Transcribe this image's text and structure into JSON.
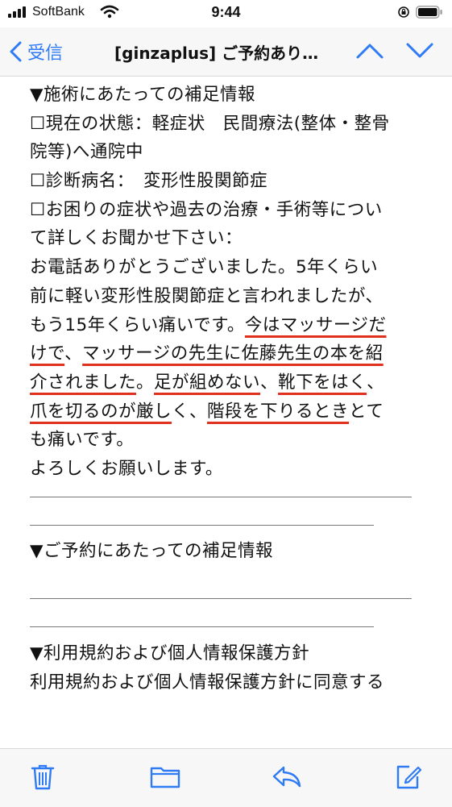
{
  "status_bar": {
    "carrier": "SoftBank",
    "time": "9:44"
  },
  "nav": {
    "back_label": "受信",
    "title": "[ginzaplus] ご予約あり…"
  },
  "body": {
    "l1": "▼施術にあたっての補足情報",
    "l2": "☐現在の状態：軽症状　民間療法(整体・整骨",
    "l3": "院等)へ通院中",
    "l4": "☐診断病名：　変形性股関節症",
    "l5": "☐お困りの症状や過去の治療・手術等につい",
    "l6": "て詳しくお聞かせ下さい：",
    "l7": "お電話ありがとうございました。5年くらい",
    "l8": "前に軽い変形性股関節症と言われましたが、",
    "l9a": "もう15年くらい痛いです。",
    "l9b": "今はマッサージだ",
    "l10a": "けで",
    "l10b": "、",
    "l10c": "マッサージの先生に佐藤先生の本を紹",
    "l11a": "介されました",
    "l11b": "。",
    "l11c": "足が組めない",
    "l11d": "、",
    "l11e": "靴下をはく",
    "l11f": "、",
    "l12a": "爪を切るのが厳し",
    "l12b": "く、",
    "l12c": "階段を下りるとき",
    "l12d": "とて",
    "l13": "も痛いです。",
    "l14": "よろしくお願いします。",
    "l15": "▼ご予約にあたっての補足情報",
    "l16": "▼利用規約および個人情報保護方針",
    "l17": "利用規約および個人情報保護方針に同意する"
  },
  "toolbar": {
    "icons": [
      "trash-icon",
      "folder-icon",
      "reply-icon",
      "compose-icon"
    ]
  },
  "colors": {
    "accent": "#2f7bf5",
    "underline": "#e0301e"
  }
}
